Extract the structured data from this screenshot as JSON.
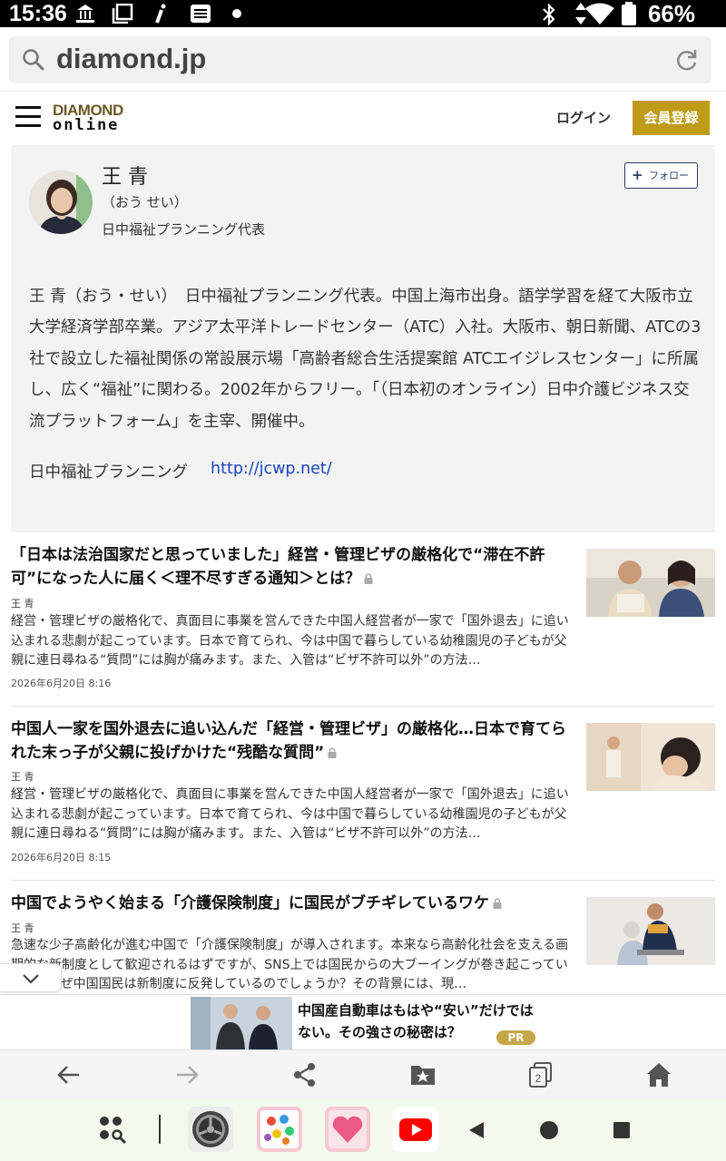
{
  "status_bar": {
    "time": "15:36",
    "battery": "66%"
  },
  "url_bar": {
    "url": "diamond.jp"
  },
  "header": {
    "logo_top": "DIAMOND",
    "logo_bottom": "online",
    "login": "ログイン",
    "register": "会員登録"
  },
  "author": {
    "name": "王 青",
    "reading": "（おう せい）",
    "title": "日中福祉プランニング代表",
    "follow": "フォロー",
    "bio": "王 青（おう・せい）　日中福祉プランニング代表。中国上海市出身。語学学習を経て大阪市立大学経済学部卒業。アジア太平洋トレードセンター（ATC）入社。大阪市、朝日新聞、ATCの3社で設立した福祉関係の常設展示場「高齢者総合生活提案館 ATCエイジレスセンター」に所属し、広く“福祉”に関わる。2002年からフリー。「（日本初のオンライン）日中介護ビジネス交流プラットフォーム」を主宰、開催中。",
    "site_name": "日中福祉プランニング",
    "site_url": "http://jcwp.net/"
  },
  "articles": [
    {
      "title": "「日本は法治国家だと思っていました」経営・管理ビザの厳格化で“滞在不許可”になった人に届く＜理不尽すぎる通知＞とは？",
      "author": "王 青",
      "summary": "経営・管理ビザの厳格化で、真面目に事業を営んできた中国人経営者が一家で「国外退去」に追い込まれる悲劇が起こっています。日本で育てられ、今は中国で暮らしている幼稚園児の子どもが父親に連日尋ねる“質問”には胸が痛みます。また、入管は“ビザ不許可以外”の方法…",
      "date": "2026年6月20日 8:16"
    },
    {
      "title": "中国人一家を国外退去に追い込んだ「経営・管理ビザ」の厳格化…日本で育てられた末っ子が父親に投げかけた“残酷な質問”",
      "author": "王 青",
      "summary": "経営・管理ビザの厳格化で、真面目に事業を営んできた中国人経営者が一家で「国外退去」に追い込まれる悲劇が起こっています。日本で育てられ、今は中国で暮らしている幼稚園児の子どもが父親に連日尋ねる“質問”には胸が痛みます。また、入管は“ビザ不許可以外”の方法…",
      "date": "2026年6月20日 8:15"
    },
    {
      "title": "中国でようやく始まる「介護保険制度」に国民がブチギレているワケ",
      "author": "王 青",
      "summary": "急速な少子高齢化が進む中国で「介護保険制度」が導入されます。本来なら高齢化社会を支える画期的な新制度として歓迎されるはずですが、SNS上では国民からの大ブーイングが巻き起こっています。なぜ中国国民は新制度に反発しているのでしょうか？その背景には、現…",
      "date": ""
    }
  ],
  "ad": {
    "text": "中国産自動車はもはや“安い”だけではない。その強さの秘密は？",
    "badge": "PR"
  },
  "toolbar": {
    "items": [
      "back-icon",
      "forward-icon",
      "share-icon",
      "bookmark-icon",
      "tabs-icon",
      "home-icon"
    ],
    "tab_count": "2"
  },
  "colors": {
    "register_bg": "#bf9b18",
    "link": "#1a44b8",
    "card_bg": "#f3f3f3",
    "follow_border": "#2b3a66"
  }
}
